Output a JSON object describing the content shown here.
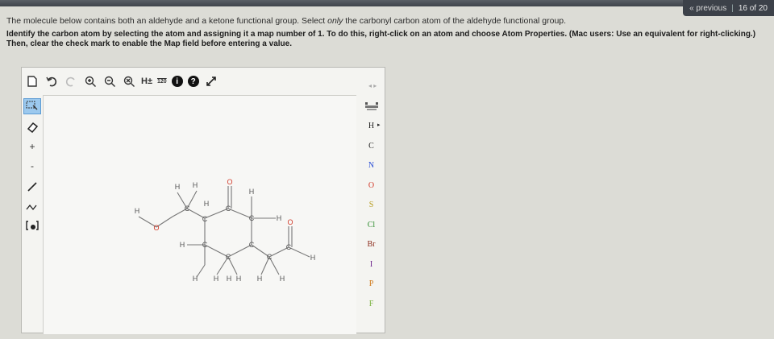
{
  "nav": {
    "previous": "« previous",
    "separator": "|",
    "counter": "16 of 20"
  },
  "question": {
    "intro_pre": "The molecule below contains both an aldehyde and a ketone functional group. Select ",
    "intro_em": "only",
    "intro_post": " the carbonyl carbon atom of the aldehyde functional group.",
    "instruction": "Identify the carbon atom by selecting the atom and assigning it a map number of 1. To do this, right-click on an atom and choose Atom Properties. (Mac users: Use an equivalent for right-clicking.) Then, clear the check mark to enable the Map field before entering a value."
  },
  "toolbar": {
    "h_label": "H±",
    "map_label": "120",
    "info_label": "i",
    "help_label": "?"
  },
  "left_tools": {
    "plus_label": "+",
    "minus_label": "-"
  },
  "elements": [
    "H",
    "C",
    "N",
    "O",
    "S",
    "Cl",
    "Br",
    "I",
    "P",
    "F"
  ],
  "element_colors": {
    "H": "#222222",
    "C": "#222222",
    "N": "#2b4fd6",
    "O": "#d23a2a",
    "S": "#b59a1a",
    "Cl": "#2e8b2e",
    "Br": "#8b2b1a",
    "I": "#6a1f8a",
    "P": "#d07a1a",
    "F": "#7cb342"
  },
  "molecule_labels": {
    "h": "H",
    "c": "C",
    "o": "O"
  }
}
